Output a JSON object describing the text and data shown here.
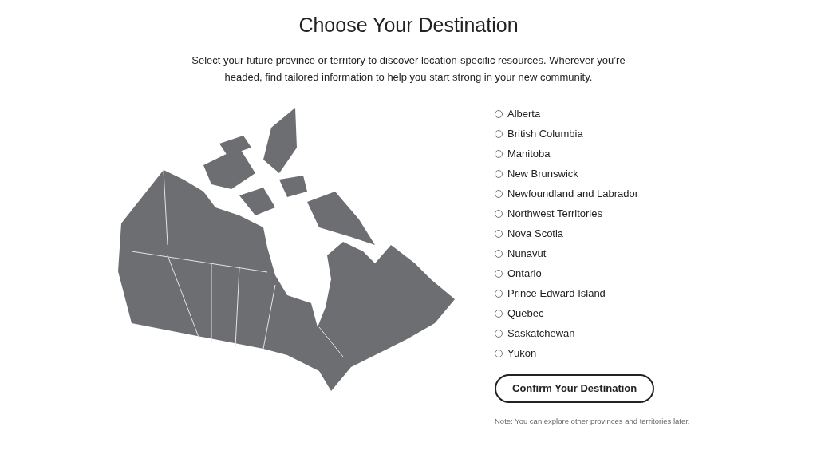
{
  "title": "Choose Your Destination",
  "intro": "Select your future province or territory to discover location-specific resources. Wherever you’re headed, find tailored information to help you start strong in your new community.",
  "options": [
    {
      "label": "Alberta",
      "selected": false
    },
    {
      "label": "British Columbia",
      "selected": false
    },
    {
      "label": "Manitoba",
      "selected": false
    },
    {
      "label": "New Brunswick",
      "selected": false
    },
    {
      "label": "Newfoundland and Labrador",
      "selected": false
    },
    {
      "label": "Northwest Territories",
      "selected": false
    },
    {
      "label": "Nova Scotia",
      "selected": false
    },
    {
      "label": "Nunavut",
      "selected": false
    },
    {
      "label": "Ontario",
      "selected": false
    },
    {
      "label": "Prince Edward Island",
      "selected": false
    },
    {
      "label": "Quebec",
      "selected": false
    },
    {
      "label": "Saskatchewan",
      "selected": false
    },
    {
      "label": "Yukon",
      "selected": false
    }
  ],
  "confirm_button": "Confirm Your Destination",
  "note": "Note: You can explore other provinces and territories later."
}
